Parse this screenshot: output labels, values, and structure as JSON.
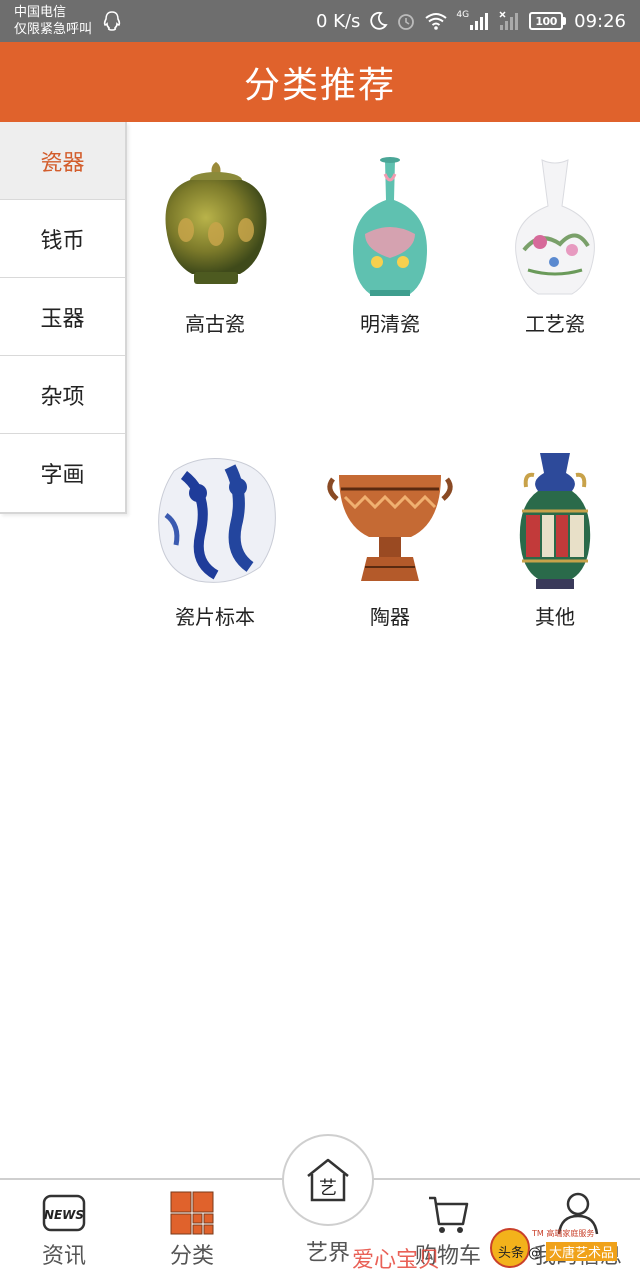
{
  "status_bar": {
    "carrier_line1": "中国电信",
    "carrier_line2": "仅限紧急呼叫",
    "network_speed": "0 K/s",
    "network_type": "4G",
    "battery": "100",
    "time": "09:26",
    "icons": [
      "qq-icon",
      "moon-icon",
      "alarm-icon",
      "wifi-icon",
      "signal-icon",
      "no-signal-icon",
      "battery-icon"
    ]
  },
  "header": {
    "title": "分类推荐"
  },
  "categories": [
    {
      "label": "瓷器",
      "active": true
    },
    {
      "label": "钱币",
      "active": false
    },
    {
      "label": "玉器",
      "active": false
    },
    {
      "label": "杂项",
      "active": false
    },
    {
      "label": "字画",
      "active": false
    }
  ],
  "items": [
    {
      "label": "高古瓷",
      "image": "green-glazed-jar"
    },
    {
      "label": "明清瓷",
      "image": "famille-rose-vase"
    },
    {
      "label": "工艺瓷",
      "image": "painted-white-vase"
    },
    {
      "label": "瓷片标本",
      "image": "blue-white-shard"
    },
    {
      "label": "陶器",
      "image": "painted-pottery-bowl"
    },
    {
      "label": "其他",
      "image": "cloisonne-vase"
    }
  ],
  "nav": {
    "items": [
      {
        "label": "资讯",
        "icon": "news-icon"
      },
      {
        "label": "分类",
        "icon": "category-grid-icon"
      },
      {
        "label": "艺界",
        "icon": "home-art-icon"
      },
      {
        "label": "购物车",
        "icon": "cart-icon"
      },
      {
        "label": "我的信息",
        "icon": "user-icon"
      }
    ],
    "news_icon_text": "NEWS",
    "center_icon_text": "艺"
  },
  "watermark": {
    "red_text": "爱心宝贝",
    "tm_text": "TM 高端家庭服务",
    "badge_text": "头条 @",
    "badge_tag": "大唐艺术品"
  },
  "colors": {
    "accent": "#e0622c",
    "active_text": "#d35d2c",
    "status_bar": "#6e6e6e"
  }
}
